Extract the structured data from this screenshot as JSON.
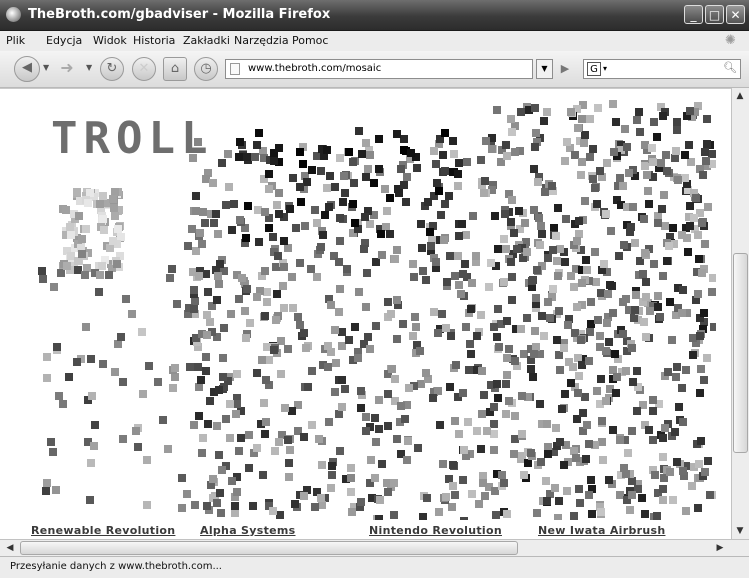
{
  "window": {
    "title": "TheBroth.com/gbadviser - Mozilla Firefox",
    "minimize_glyph": "_",
    "maximize_glyph": "□",
    "close_glyph": "✕"
  },
  "menu": [
    "Plik",
    "Edycja",
    "Widok",
    "Historia",
    "Zakładki",
    "Narzędzia",
    "Pomoc"
  ],
  "toolbar": {
    "url": "www.thebroth.com/mosaic",
    "search_engine": "G",
    "icons": [
      "back-icon",
      "forward-icon",
      "reload-icon",
      "stop-icon",
      "home-icon",
      "history-icon"
    ]
  },
  "content": {
    "mosaic_text": "TROLL",
    "links": [
      "Renewable Revolution",
      "Alpha Systems",
      "Nintendo Revolution",
      "New Iwata Airbrush"
    ]
  },
  "status": {
    "text": "Przesyłanie danych z www.thebroth.com..."
  },
  "colors": {
    "titlebar": "#3b3b3b",
    "tile_dark": "#000000",
    "tile_mid": "#5f5f5f",
    "tile_light": "#c8c8c8"
  }
}
